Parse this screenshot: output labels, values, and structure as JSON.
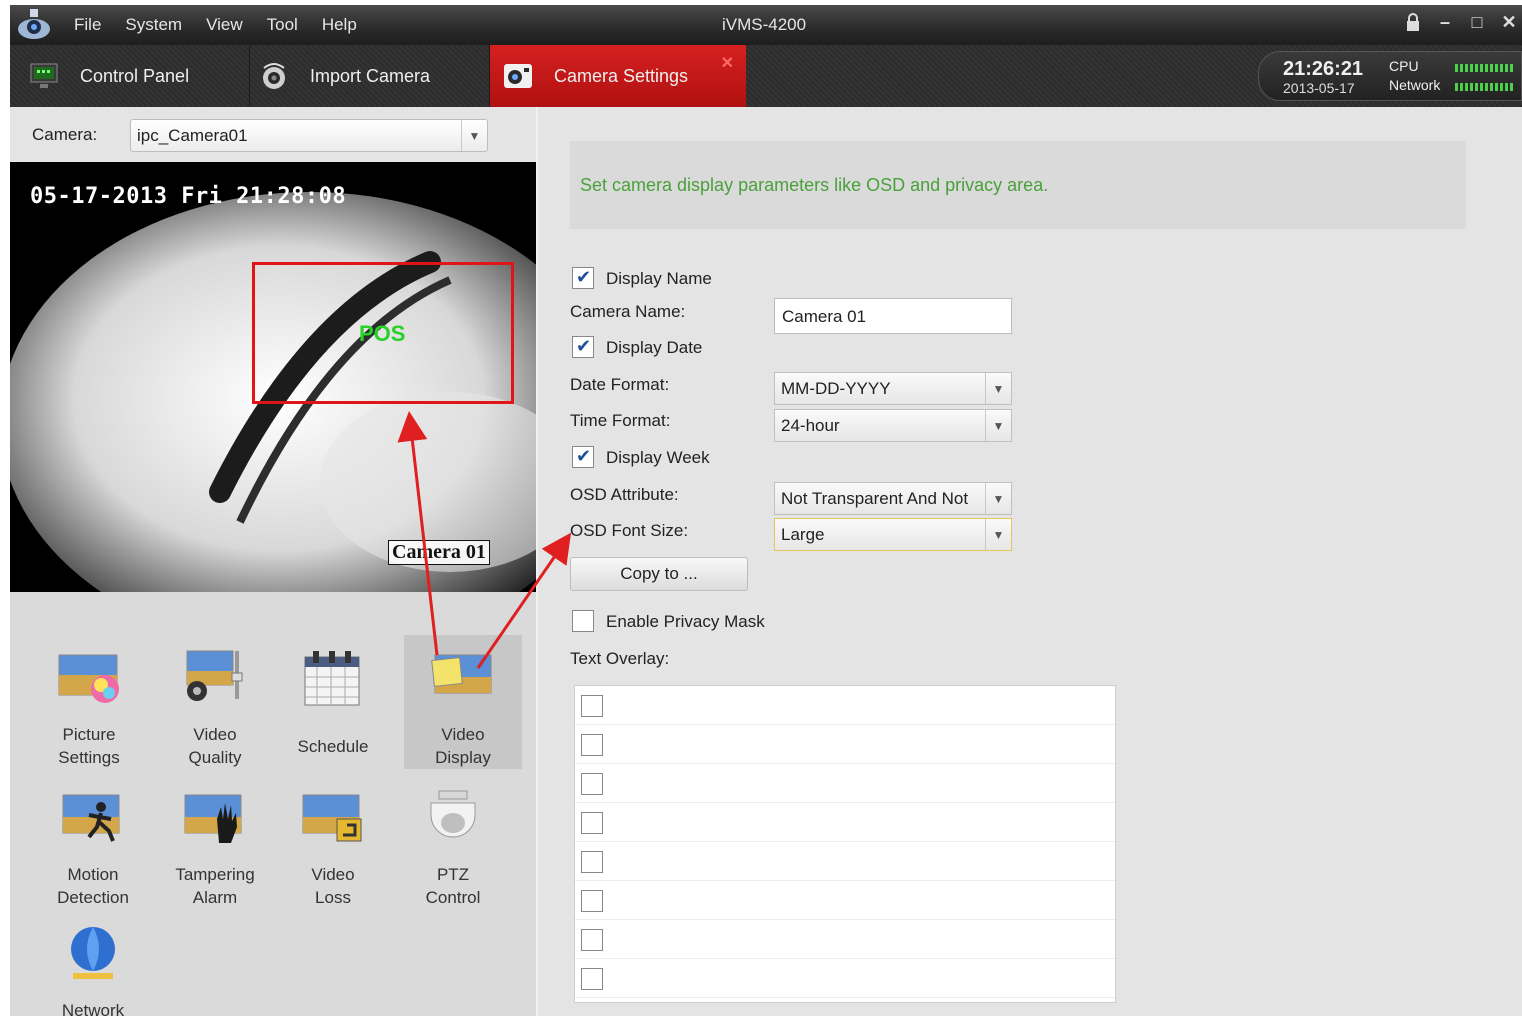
{
  "app": {
    "title": "iVMS-4200",
    "menu": [
      "File",
      "System",
      "View",
      "Tool",
      "Help"
    ]
  },
  "tabs": [
    {
      "label": "Control Panel"
    },
    {
      "label": "Import Camera"
    },
    {
      "label": "Camera Settings",
      "active": true
    }
  ],
  "status": {
    "time": "21:26:21",
    "date": "2013-05-17",
    "cpu_label": "CPU",
    "network_label": "Network"
  },
  "left": {
    "camera_label": "Camera:",
    "camera_value": "ipc_Camera01",
    "preview": {
      "osd_date": "05-17-2013 Fri 21:28:08",
      "osd_name": "Camera 01",
      "privacy_label": "POS"
    },
    "functions": [
      {
        "label1": "Picture",
        "label2": "Settings",
        "icon": "picture-settings-icon"
      },
      {
        "label1": "Video",
        "label2": "Quality",
        "icon": "video-quality-icon"
      },
      {
        "label1": "Schedule",
        "label2": "",
        "icon": "calendar-icon"
      },
      {
        "label1": "Video",
        "label2": "Display",
        "icon": "video-display-icon",
        "active": true
      },
      {
        "label1": "Motion",
        "label2": "Detection",
        "icon": "motion-detection-icon"
      },
      {
        "label1": "Tampering",
        "label2": "Alarm",
        "icon": "tampering-alarm-icon"
      },
      {
        "label1": "Video",
        "label2": "Loss",
        "icon": "video-loss-icon"
      },
      {
        "label1": "PTZ",
        "label2": "Control",
        "icon": "ptz-dome-icon"
      },
      {
        "label1": "Network",
        "label2": "",
        "icon": "network-globe-icon"
      }
    ]
  },
  "right": {
    "hint": "Set camera display parameters like OSD and privacy area.",
    "display_name": {
      "label": "Display Name",
      "checked": true
    },
    "camera_name": {
      "label": "Camera Name:",
      "value": "Camera 01"
    },
    "display_date": {
      "label": "Display Date",
      "checked": true
    },
    "date_format": {
      "label": "Date Format:",
      "value": "MM-DD-YYYY"
    },
    "time_format": {
      "label": "Time Format:",
      "value": "24-hour"
    },
    "display_week": {
      "label": "Display Week",
      "checked": true
    },
    "osd_attribute": {
      "label": "OSD Attribute:",
      "value": "Not Transparent And Not"
    },
    "osd_font_size": {
      "label": "OSD Font Size:",
      "value": "Large"
    },
    "copy_to": "Copy to ...",
    "privacy_mask": {
      "label": "Enable Privacy Mask",
      "checked": false
    },
    "text_overlay_label": "Text Overlay:",
    "text_overlay_rows": [
      false,
      false,
      false,
      false,
      false,
      false,
      false,
      false
    ]
  }
}
